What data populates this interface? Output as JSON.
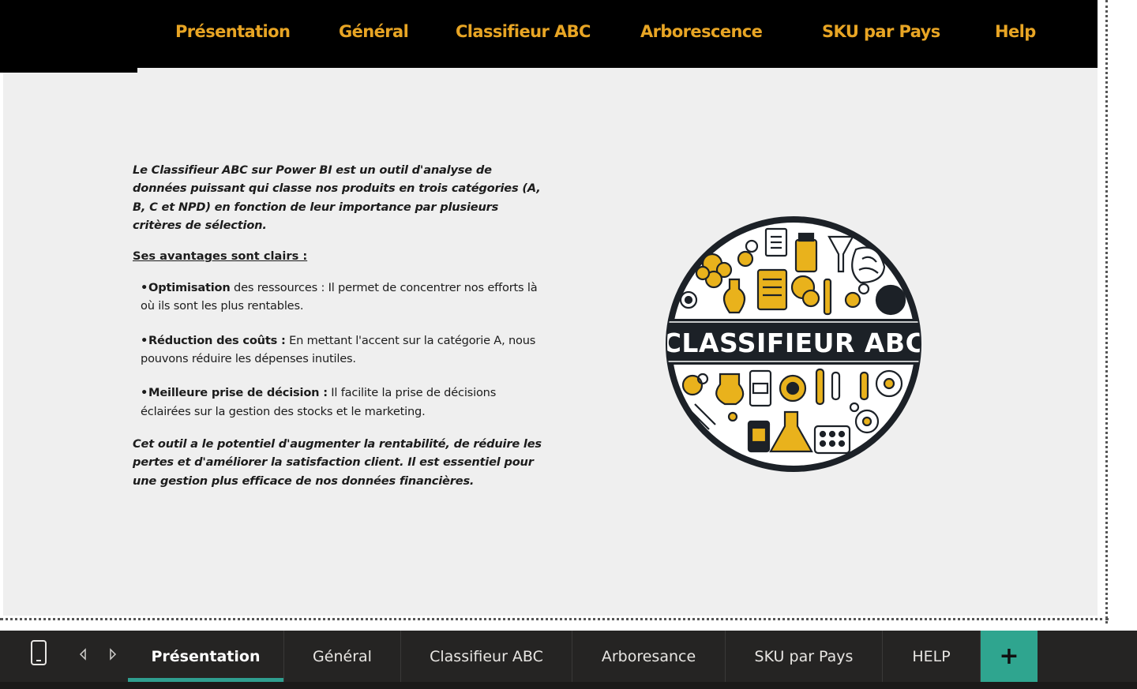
{
  "nav": {
    "items": [
      {
        "label": "Présentation"
      },
      {
        "label": "Général"
      },
      {
        "label": "Classifieur ABC"
      },
      {
        "label": "Arborescence"
      },
      {
        "label": "SKU par Pays"
      },
      {
        "label": "Help"
      }
    ],
    "accent_color": "#e8a524"
  },
  "content": {
    "intro": "Le Classifieur ABC sur Power BI est un outil d'analyse de données puissant qui classe nos produits en trois catégories (A, B, C et NPD) en fonction de leur importance par plusieurs critères de sélection.",
    "subheading": "Ses avantages sont clairs :",
    "bullets": [
      {
        "bold": "Optimisation",
        "text": " des ressources : Il permet de concentrer nos efforts là où ils sont les plus rentables."
      },
      {
        "bold": "Réduction des coûts :",
        "text": " En mettant l'accent sur la catégorie A, nous pouvons réduire les dépenses inutiles."
      },
      {
        "bold": "Meilleure prise de décision :",
        "text": " Il facilite la prise de décisions éclairées sur la gestion des stocks et le marketing."
      }
    ],
    "bullet_glyph": "•",
    "outro": "Cet outil a le potentiel d'augmenter la rentabilité, de réduire les pertes et d'améliorer la satisfaction client. Il est essentiel pour une gestion plus efficace de nos données financières."
  },
  "logo": {
    "label": "CLASSIFIEUR ABC",
    "icon_name": "classifieur-abc-logo",
    "colors": {
      "dark": "#1c2127",
      "gold": "#e9b21c",
      "light": "#ffffff"
    }
  },
  "tabbar": {
    "tabs": [
      {
        "label": "Présentation",
        "active": true
      },
      {
        "label": "Général",
        "active": false
      },
      {
        "label": "Classifieur ABC",
        "active": false
      },
      {
        "label": "Arboresance",
        "active": false
      },
      {
        "label": "SKU par Pays",
        "active": false
      },
      {
        "label": "HELP",
        "active": false
      }
    ],
    "add_label": "+",
    "active_color": "#2f9e8f"
  }
}
